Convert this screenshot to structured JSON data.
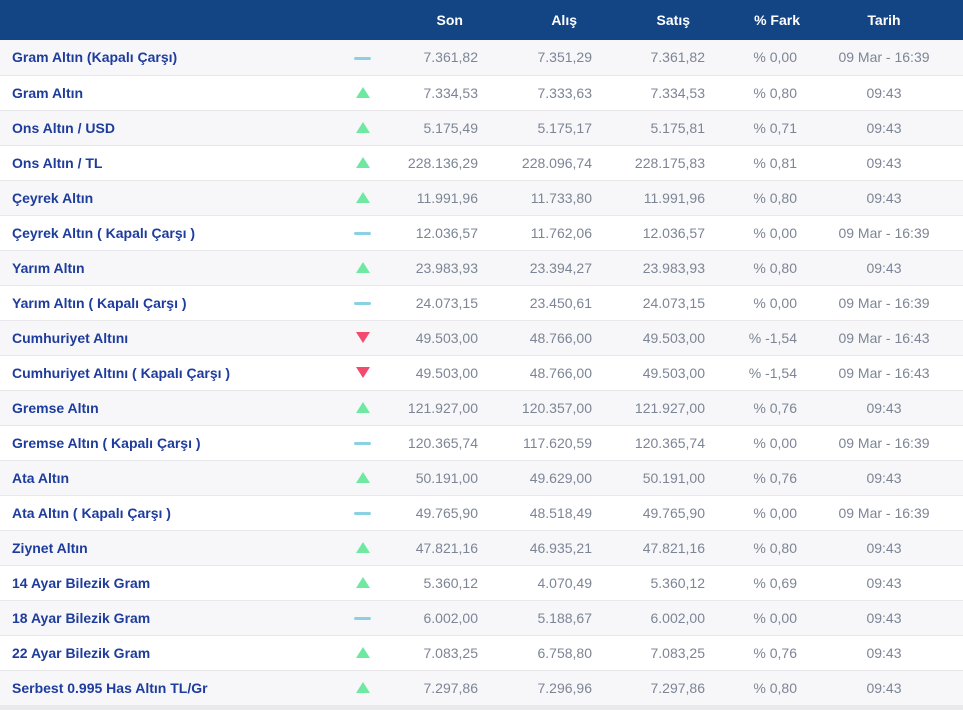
{
  "colors": {
    "header_bg": "#134484",
    "header_text": "#ffffff",
    "name_text": "#1e3c9c",
    "value_text": "#7c8595",
    "up": "#6fe8a2",
    "down": "#f44a6e",
    "flat": "#8bd1e4",
    "row_alt_bg": "#f7f7f9",
    "divider": "#e8e8ea",
    "page_bg": "#e9e9ec"
  },
  "table": {
    "columns": [
      "Son",
      "Alış",
      "Satış",
      "% Fark",
      "Tarih"
    ],
    "rows": [
      {
        "name": "Gram Altın (Kapalı Çarşı)",
        "trend": "flat",
        "son": "7.361,82",
        "alis": "7.351,29",
        "satis": "7.361,82",
        "fark": "% 0,00",
        "tarih": "09 Mar - 16:39"
      },
      {
        "name": "Gram Altın",
        "trend": "up",
        "son": "7.334,53",
        "alis": "7.333,63",
        "satis": "7.334,53",
        "fark": "% 0,80",
        "tarih": "09:43"
      },
      {
        "name": "Ons Altın / USD",
        "trend": "up",
        "son": "5.175,49",
        "alis": "5.175,17",
        "satis": "5.175,81",
        "fark": "% 0,71",
        "tarih": "09:43"
      },
      {
        "name": "Ons Altın / TL",
        "trend": "up",
        "son": "228.136,29",
        "alis": "228.096,74",
        "satis": "228.175,83",
        "fark": "% 0,81",
        "tarih": "09:43"
      },
      {
        "name": "Çeyrek Altın",
        "trend": "up",
        "son": "11.991,96",
        "alis": "11.733,80",
        "satis": "11.991,96",
        "fark": "% 0,80",
        "tarih": "09:43"
      },
      {
        "name": "Çeyrek Altın ( Kapalı Çarşı )",
        "trend": "flat",
        "son": "12.036,57",
        "alis": "11.762,06",
        "satis": "12.036,57",
        "fark": "% 0,00",
        "tarih": "09 Mar - 16:39"
      },
      {
        "name": "Yarım Altın",
        "trend": "up",
        "son": "23.983,93",
        "alis": "23.394,27",
        "satis": "23.983,93",
        "fark": "% 0,80",
        "tarih": "09:43"
      },
      {
        "name": "Yarım Altın ( Kapalı Çarşı )",
        "trend": "flat",
        "son": "24.073,15",
        "alis": "23.450,61",
        "satis": "24.073,15",
        "fark": "% 0,00",
        "tarih": "09 Mar - 16:39"
      },
      {
        "name": "Cumhuriyet Altını",
        "trend": "down",
        "son": "49.503,00",
        "alis": "48.766,00",
        "satis": "49.503,00",
        "fark": "% -1,54",
        "tarih": "09 Mar - 16:43"
      },
      {
        "name": "Cumhuriyet Altını ( Kapalı Çarşı )",
        "trend": "down",
        "son": "49.503,00",
        "alis": "48.766,00",
        "satis": "49.503,00",
        "fark": "% -1,54",
        "tarih": "09 Mar - 16:43"
      },
      {
        "name": "Gremse Altın",
        "trend": "up",
        "son": "121.927,00",
        "alis": "120.357,00",
        "satis": "121.927,00",
        "fark": "% 0,76",
        "tarih": "09:43"
      },
      {
        "name": "Gremse Altın ( Kapalı Çarşı )",
        "trend": "flat",
        "son": "120.365,74",
        "alis": "117.620,59",
        "satis": "120.365,74",
        "fark": "% 0,00",
        "tarih": "09 Mar - 16:39"
      },
      {
        "name": "Ata Altın",
        "trend": "up",
        "son": "50.191,00",
        "alis": "49.629,00",
        "satis": "50.191,00",
        "fark": "% 0,76",
        "tarih": "09:43"
      },
      {
        "name": "Ata Altın ( Kapalı Çarşı )",
        "trend": "flat",
        "son": "49.765,90",
        "alis": "48.518,49",
        "satis": "49.765,90",
        "fark": "% 0,00",
        "tarih": "09 Mar - 16:39"
      },
      {
        "name": "Ziynet Altın",
        "trend": "up",
        "son": "47.821,16",
        "alis": "46.935,21",
        "satis": "47.821,16",
        "fark": "% 0,80",
        "tarih": "09:43"
      },
      {
        "name": "14 Ayar Bilezik Gram",
        "trend": "up",
        "son": "5.360,12",
        "alis": "4.070,49",
        "satis": "5.360,12",
        "fark": "% 0,69",
        "tarih": "09:43"
      },
      {
        "name": "18 Ayar Bilezik Gram",
        "trend": "flat",
        "son": "6.002,00",
        "alis": "5.188,67",
        "satis": "6.002,00",
        "fark": "% 0,00",
        "tarih": "09:43"
      },
      {
        "name": "22 Ayar Bilezik Gram",
        "trend": "up",
        "son": "7.083,25",
        "alis": "6.758,80",
        "satis": "7.083,25",
        "fark": "% 0,76",
        "tarih": "09:43"
      },
      {
        "name": "Serbest 0.995 Has Altın TL/Gr",
        "trend": "up",
        "son": "7.297,86",
        "alis": "7.296,96",
        "satis": "7.297,86",
        "fark": "% 0,80",
        "tarih": "09:43"
      }
    ]
  }
}
